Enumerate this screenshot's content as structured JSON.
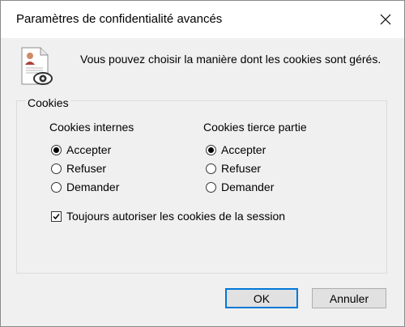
{
  "window": {
    "title": "Paramètres de confidentialité avancés"
  },
  "intro": {
    "icon": "privacy-document-eye-icon",
    "text": "Vous pouvez choisir la manière dont les cookies sont gérés."
  },
  "cookies": {
    "group_label": "Cookies",
    "first_party": {
      "header": "Cookies internes",
      "options": [
        "Accepter",
        "Refuser",
        "Demander"
      ],
      "selected": "Accepter"
    },
    "third_party": {
      "header": "Cookies tierce partie",
      "options": [
        "Accepter",
        "Refuser",
        "Demander"
      ],
      "selected": "Accepter"
    },
    "session_checkbox": {
      "label": "Toujours autoriser les cookies de la session",
      "checked": true
    }
  },
  "buttons": {
    "ok": "OK",
    "cancel": "Annuler"
  },
  "colors": {
    "default_button_border": "#0078d7",
    "button_bg": "#e1e1e1",
    "dialog_bg": "#f0f0f0"
  }
}
